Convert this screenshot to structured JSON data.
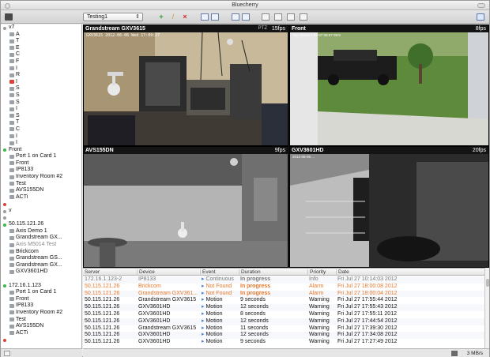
{
  "window": {
    "title": "Bluecherry"
  },
  "toolbar": {
    "layout_name": "Testing1",
    "add_label": "+",
    "edit_label": "/",
    "delete_label": "×"
  },
  "sidebar": {
    "rows": [
      {
        "label": "v7",
        "type": "server",
        "status": "#9a9a9a",
        "indent": 0
      },
      {
        "label": "A",
        "type": "cam",
        "indent": 1
      },
      {
        "label": "T",
        "type": "cam",
        "indent": 1
      },
      {
        "label": "E",
        "type": "cam",
        "indent": 1
      },
      {
        "label": "C",
        "type": "cam",
        "indent": 1
      },
      {
        "label": "F",
        "type": "cam",
        "indent": 1
      },
      {
        "label": "I",
        "type": "cam",
        "indent": 1
      },
      {
        "label": "R",
        "type": "cam",
        "indent": 1
      },
      {
        "label": "I",
        "type": "cam-red",
        "indent": 1
      },
      {
        "label": "S",
        "type": "cam",
        "indent": 1
      },
      {
        "label": "S",
        "type": "cam",
        "indent": 1
      },
      {
        "label": "S",
        "type": "cam",
        "indent": 1
      },
      {
        "label": "I",
        "type": "cam",
        "indent": 1
      },
      {
        "label": "S",
        "type": "cam",
        "indent": 1
      },
      {
        "label": "T",
        "type": "cam",
        "indent": 1
      },
      {
        "label": "C",
        "type": "cam",
        "indent": 1
      },
      {
        "label": "I",
        "type": "cam",
        "indent": 1
      },
      {
        "label": "I",
        "type": "cam",
        "indent": 1
      },
      {
        "label": "Front",
        "type": "server",
        "status": "#3bb54a",
        "indent": 0
      },
      {
        "label": "Port 1 on Card 1",
        "type": "cam",
        "indent": 1
      },
      {
        "label": "Front",
        "type": "cam",
        "indent": 1
      },
      {
        "label": "IP8133",
        "type": "cam",
        "indent": 1
      },
      {
        "label": "Inventory Room #2",
        "type": "cam",
        "indent": 1
      },
      {
        "label": "Test",
        "type": "cam",
        "indent": 1
      },
      {
        "label": "AVS155DN",
        "type": "cam",
        "indent": 1
      },
      {
        "label": "ACTi",
        "type": "cam",
        "indent": 1
      },
      {
        "label": "",
        "type": "server",
        "status": "#d9443a",
        "indent": 0
      },
      {
        "label": "v",
        "type": "server",
        "status": "#9a9a9a",
        "indent": 0
      },
      {
        "label": "",
        "type": "server",
        "status": "#9a9a9a",
        "indent": 0
      },
      {
        "label": "50.115.121.26",
        "type": "server",
        "status": "#3bb54a",
        "indent": 0
      },
      {
        "label": "Axis Demo 1",
        "type": "cam",
        "indent": 1
      },
      {
        "label": "Grandstream GX...",
        "type": "cam",
        "indent": 1
      },
      {
        "label": "Axis M5014 Test",
        "type": "cam",
        "indent": 1,
        "dim": true
      },
      {
        "label": "Brickcom",
        "type": "cam",
        "indent": 1
      },
      {
        "label": "Grandstream GS...",
        "type": "cam",
        "indent": 1
      },
      {
        "label": "Grandstream GX...",
        "type": "cam",
        "indent": 1
      },
      {
        "label": "GXV3601HD",
        "type": "cam",
        "indent": 1
      },
      {
        "label": "",
        "type": "blank",
        "indent": 0
      },
      {
        "label": "172.16.1.123",
        "type": "server",
        "status": "#3bb54a",
        "indent": 0
      },
      {
        "label": "Port 1 on Card 1",
        "type": "cam",
        "indent": 1
      },
      {
        "label": "Front",
        "type": "cam",
        "indent": 1
      },
      {
        "label": "IP8133",
        "type": "cam",
        "indent": 1
      },
      {
        "label": "Inventory Room #2",
        "type": "cam",
        "indent": 1
      },
      {
        "label": "Test",
        "type": "cam",
        "indent": 1
      },
      {
        "label": "AVS155DN",
        "type": "cam",
        "indent": 1
      },
      {
        "label": "ACTi",
        "type": "cam",
        "indent": 1
      },
      {
        "label": "",
        "type": "server",
        "status": "#d9443a",
        "indent": 0
      }
    ]
  },
  "feeds": [
    {
      "name": "Grandstream GXV3615",
      "fps": "15fps",
      "ptz": "PTZ",
      "overlay": "GXV3615  2012-06-06 Wed  17:09:27",
      "scene": "lab"
    },
    {
      "name": "Front",
      "fps": "8fps",
      "ptz": "",
      "overlay": "Axis Demo 1 06-07  06:57 09:8",
      "scene": "driveway"
    },
    {
      "name": "AVS155DN",
      "fps": "9fps",
      "ptz": "",
      "overlay": "",
      "scene": "room"
    },
    {
      "name": "GXV3601HD",
      "fps": "20fps",
      "ptz": "",
      "overlay": "2012-06-06 ...",
      "scene": "hall"
    }
  ],
  "events": {
    "columns": [
      "Server",
      "Device",
      "Event",
      "Duration",
      "Priority",
      "Date"
    ],
    "rows": [
      {
        "server": "172.16.1.123-2",
        "device": "IP8133",
        "event": "Continuous",
        "duration": "In progress",
        "priority": "Info",
        "date": "Fri Jul 27 10:14:03 2012",
        "color": "#777777"
      },
      {
        "server": "50.115.121.26",
        "device": "Brickcom",
        "event": "Not Found",
        "duration": "In progress",
        "priority": "Alarm",
        "date": "Fri Jul 27 18:00:08 2012",
        "color": "#e8772a"
      },
      {
        "server": "50.115.121.26",
        "device": "Grandstream GXV361...",
        "event": "Not Found",
        "duration": "In progress",
        "priority": "Alarm",
        "date": "Fri Jul 27 18:00:04 2012",
        "color": "#e8772a"
      },
      {
        "server": "50.115.121.26",
        "device": "Grandstream GXV3615",
        "event": "Motion",
        "duration": "9 seconds",
        "priority": "Warning",
        "date": "Fri Jul 27 17:55:44 2012",
        "color": "#111111"
      },
      {
        "server": "50.115.121.26",
        "device": "GXV3601HD",
        "event": "Motion",
        "duration": "12 seconds",
        "priority": "Warning",
        "date": "Fri Jul 27 17:55:43 2012",
        "color": "#111111"
      },
      {
        "server": "50.115.121.26",
        "device": "GXV3601HD",
        "event": "Motion",
        "duration": "8 seconds",
        "priority": "Warning",
        "date": "Fri Jul 27 17:55:11 2012",
        "color": "#111111"
      },
      {
        "server": "50.115.121.26",
        "device": "GXV3601HD",
        "event": "Motion",
        "duration": "12 seconds",
        "priority": "Warning",
        "date": "Fri Jul 27 17:44:54 2012",
        "color": "#111111"
      },
      {
        "server": "50.115.121.26",
        "device": "Grandstream GXV3615",
        "event": "Motion",
        "duration": "11 seconds",
        "priority": "Warning",
        "date": "Fri Jul 27 17:39:30 2012",
        "color": "#111111"
      },
      {
        "server": "50.115.121.26",
        "device": "GXV3601HD",
        "event": "Motion",
        "duration": "12 seconds",
        "priority": "Warning",
        "date": "Fri Jul 27 17:34:08 2012",
        "color": "#111111"
      },
      {
        "server": "50.115.121.26",
        "device": "GXV3601HD",
        "event": "Motion",
        "duration": "9 seconds",
        "priority": "Warning",
        "date": "Fri Jul 27 17:27:49 2012",
        "color": "#111111"
      }
    ]
  },
  "status": {
    "rate": "3 MB/s"
  }
}
